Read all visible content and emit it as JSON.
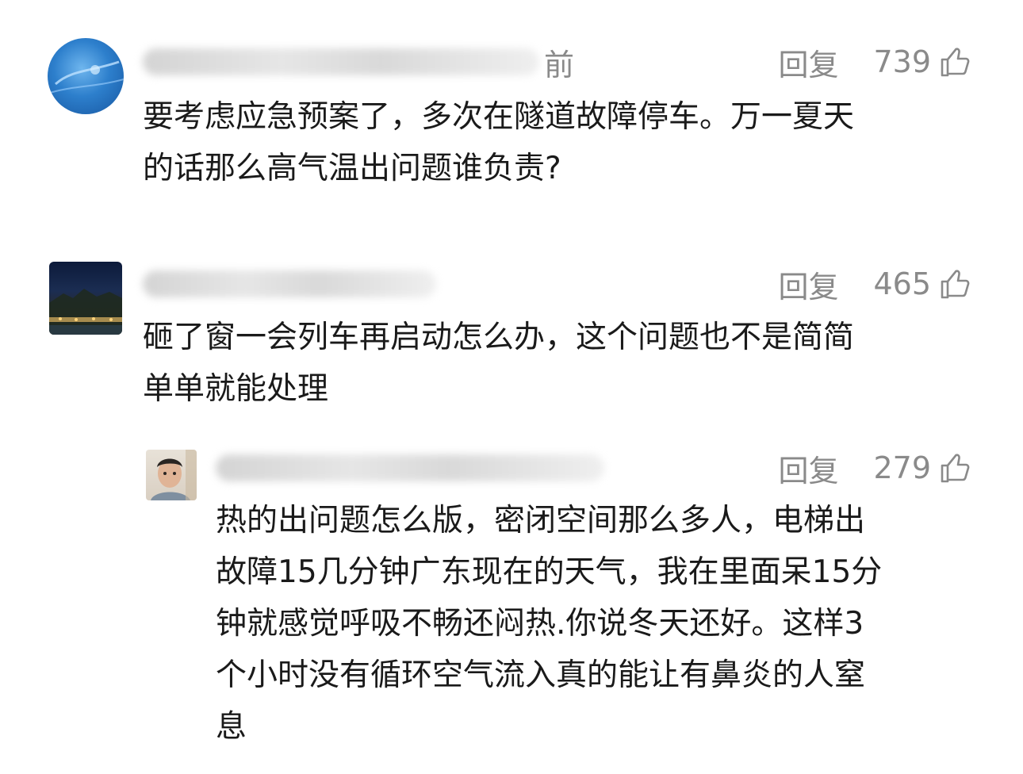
{
  "comments": [
    {
      "name_suffix": "前",
      "reply_label": "回复",
      "likes": "739",
      "lines": [
        "要考虑应急预案了，多次在隧道故障停车。万一夏天",
        "的话那么高气温出问题谁负责?"
      ]
    },
    {
      "name_suffix": "",
      "reply_label": "回复",
      "likes": "465",
      "lines": [
        "砸了窗一会列车再启动怎么办，这个问题也不是简简",
        "单单就能处理"
      ]
    },
    {
      "name_suffix": "",
      "reply_label": "回复",
      "likes": "279",
      "lines": [
        "热的出问题怎么版，密闭空间那么多人，电梯出",
        "故障15几分钟广东现在的天气，我在里面呆15分",
        "钟就感觉呼吸不畅还闷热.你说冬天还好。这样3",
        "个小时没有循环空气流入真的能让有鼻炎的人窒",
        "息"
      ]
    }
  ],
  "icons": {
    "like": "thumbs-up-icon"
  },
  "colors": {
    "text": "#1a1a1a",
    "meta": "#8a8a8a",
    "background": "#ffffff"
  }
}
